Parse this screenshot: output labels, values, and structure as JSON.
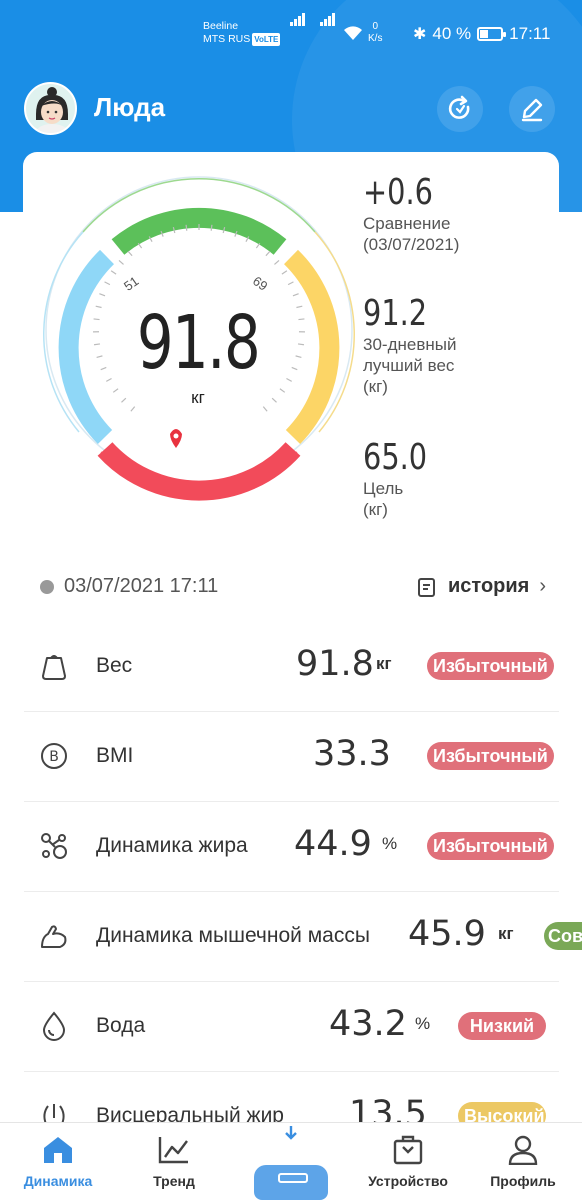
{
  "status_bar": {
    "carrier_1": "Beeline",
    "carrier_2": "MTS RUS",
    "volte": "VoLTE",
    "net_speed_value": "0",
    "net_speed_unit": "K/s",
    "battery": "40 %",
    "time": "17:11"
  },
  "header": {
    "user_name": "Люда",
    "sync_icon": "sync-icon",
    "edit_icon": "edit-icon"
  },
  "gauge": {
    "value": "91.8",
    "unit": "кг",
    "scale_low": "51",
    "scale_high": "69",
    "colors": {
      "green": "#5cc05a",
      "yellow": "#fcd566",
      "red": "#f24b5a",
      "blue": "#8fd7f7"
    }
  },
  "stats": [
    {
      "value": "+0.6",
      "label_1": "Сравнение",
      "label_2": "(03/07/2021)",
      "label_3": ""
    },
    {
      "value": "91.2",
      "label_1": "30-дневный",
      "label_2": "лучший вес",
      "label_3": "(кг)"
    },
    {
      "value": "65.0",
      "label_1": "Цель",
      "label_2": "(кг)",
      "label_3": ""
    }
  ],
  "measurement_time": "03/07/2021 17:11",
  "history_label": "история",
  "metrics": [
    {
      "name": "Вес",
      "value": "91.8",
      "unit": "кг",
      "badge": "Избыточный",
      "badge_color": "#e0707a",
      "icon": "weight-icon"
    },
    {
      "name": "BMI",
      "value": "33.3",
      "unit": "",
      "badge": "Избыточный",
      "badge_color": "#e0707a",
      "icon": "bmi-icon"
    },
    {
      "name": "Динамика жира",
      "value": "44.9",
      "unit": "%",
      "badge": "Избыточный",
      "badge_color": "#e0707a",
      "icon": "fat-icon"
    },
    {
      "name": "Динамика мышечной массы",
      "value": "45.9",
      "unit": "кг",
      "badge": "Сов",
      "badge_color": "#7aa857",
      "icon": "muscle-icon"
    },
    {
      "name": "Вода",
      "value": "43.2",
      "unit": "%",
      "badge": "Низкий",
      "badge_color": "#e0707a",
      "icon": "water-drop-icon"
    },
    {
      "name": "Висцеральный жир",
      "value": "13.5",
      "unit": "",
      "badge": "Высокий",
      "badge_color": "#ecc864",
      "icon": "visceral-fat-icon"
    }
  ],
  "nav": {
    "dynamics": "Динамика",
    "trend": "Тренд",
    "device": "Устройство",
    "profile": "Профиль",
    "accent": "#3a8ee0"
  }
}
